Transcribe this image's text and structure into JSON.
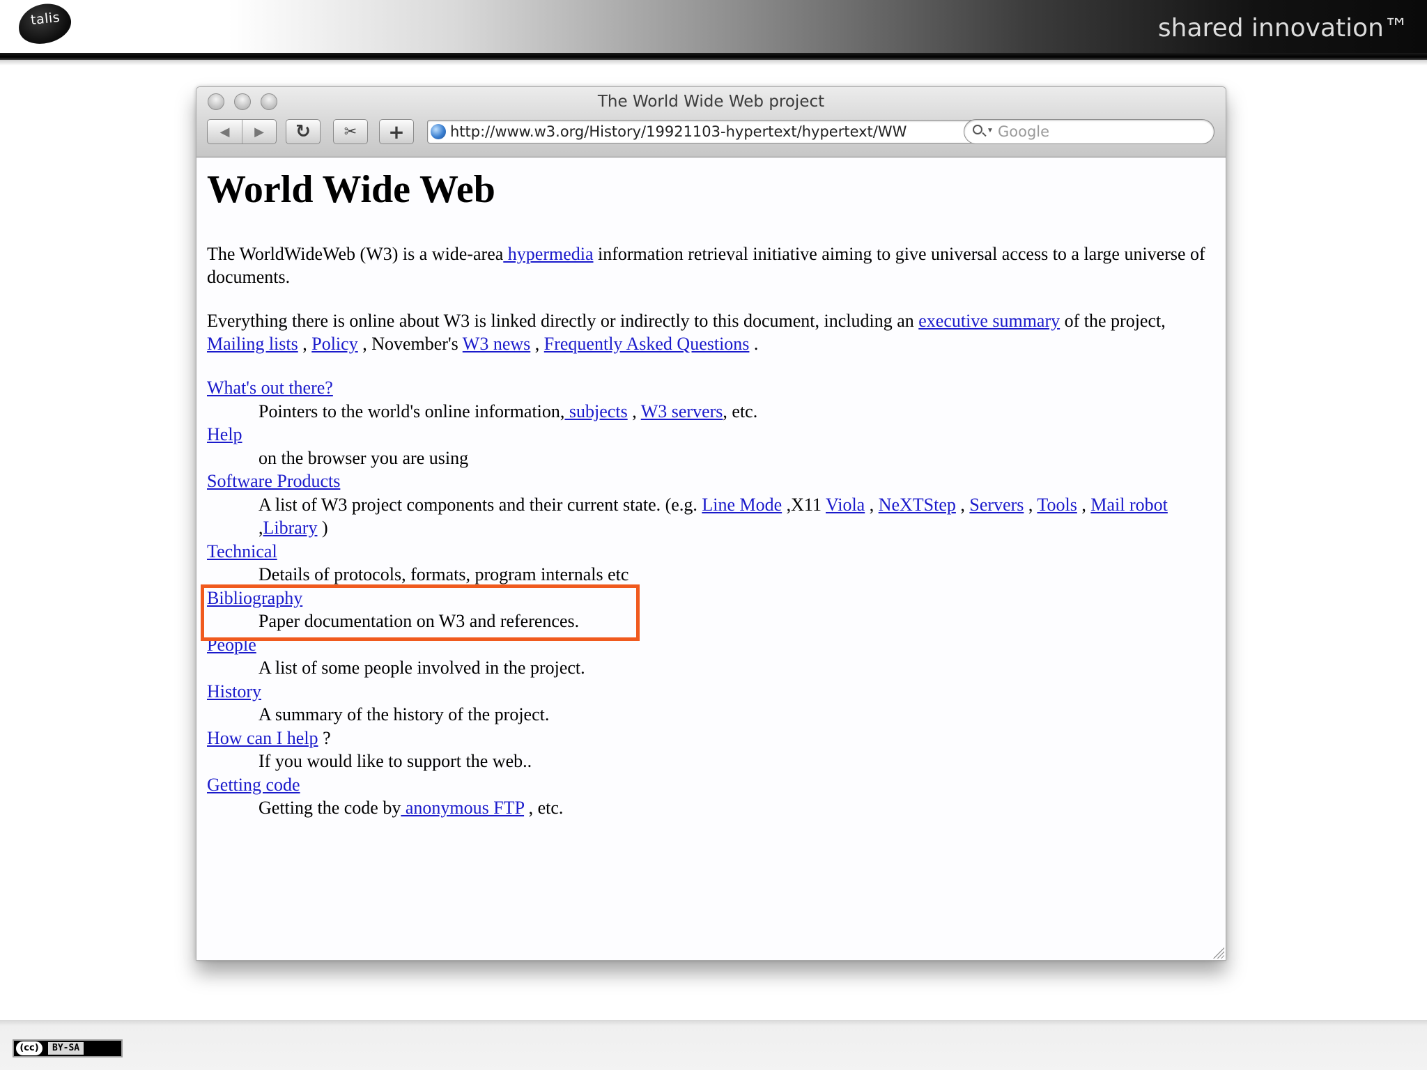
{
  "slide": {
    "logo_text": "talis",
    "tagline": "shared innovation™",
    "license_cc": "(cc)",
    "license_text": "BY-SA"
  },
  "browser": {
    "window_title": "The World Wide Web project",
    "toolbar": {
      "back_label": "◀",
      "forward_label": "▶",
      "reload_label": "↻",
      "snip_label": "✂",
      "add_label": "+"
    },
    "url": "http://www.w3.org/History/19921103-hypertext/hypertext/WW",
    "url_stop_label": "˄",
    "search_placeholder": "Google"
  },
  "page": {
    "title": "World Wide Web",
    "intro": {
      "before": "The WorldWideWeb (W3) is a wide-area",
      "link": " hypermedia",
      "after": " information retrieval initiative aiming to give universal access to a large universe of documents."
    },
    "everything": {
      "t1": "Everything there is online about W3 is linked directly or indirectly to this document, including an ",
      "link_exec": "executive summary",
      "t2": " of the project, ",
      "link_mailing": "Mailing lists",
      "t3": " , ",
      "link_policy": "Policy",
      "t4": " , November's ",
      "link_news": "W3 news",
      "t5": " , ",
      "link_faq": "Frequently Asked Questions",
      "t6": " ."
    },
    "items": [
      {
        "term": "What's out there?",
        "desc_before": "Pointers to the world's online information,",
        "link1": " subjects",
        "mid": " , ",
        "link2": "W3 servers",
        "desc_after": ", etc."
      },
      {
        "term": "Help",
        "desc": "on the browser you are using"
      },
      {
        "term": "Software Products",
        "desc_before": "A list of W3 project components and their current state. (e.g. ",
        "links": [
          "Line Mode",
          "Viola",
          "NeXTStep",
          "Servers",
          "Tools",
          "Mail robot",
          "Library"
        ],
        "sep_x11": " ,X11 ",
        "sep": " , ",
        "sep_lib": " ,",
        "close": " )"
      },
      {
        "term": "Technical",
        "desc": "Details of protocols, formats, program internals etc"
      },
      {
        "term": "Bibliography",
        "desc": "Paper documentation on W3 and references."
      },
      {
        "term": "People",
        "desc": "A list of some people involved in the project."
      },
      {
        "term": "History",
        "desc": "A summary of the history of the project."
      },
      {
        "term": "How can I help",
        "term_suffix": " ?",
        "desc": "If you would like to support the web.."
      },
      {
        "term": "Getting code",
        "desc_before": "Getting the code by",
        "link1": " anonymous FTP",
        "desc_after": " , etc."
      }
    ]
  },
  "colors": {
    "link": "#1a1acb",
    "highlight_box": "#f05a1e"
  }
}
